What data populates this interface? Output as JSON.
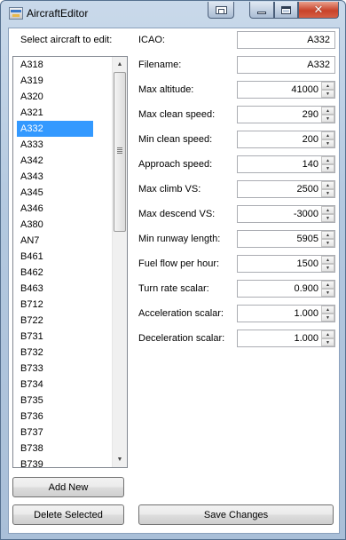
{
  "window": {
    "title": "AircraftEditor"
  },
  "list": {
    "label": "Select aircraft to edit:",
    "selected": "A332",
    "items": [
      "A318",
      "A319",
      "A320",
      "A321",
      "A332",
      "A333",
      "A342",
      "A343",
      "A345",
      "A346",
      "A380",
      "AN7",
      "B461",
      "B462",
      "B463",
      "B712",
      "B722",
      "B731",
      "B732",
      "B733",
      "B734",
      "B735",
      "B736",
      "B737",
      "B738",
      "B739"
    ]
  },
  "fields": {
    "icao": {
      "label": "ICAO:",
      "value": "A332"
    },
    "filename": {
      "label": "Filename:",
      "value": "A332"
    },
    "max_altitude": {
      "label": "Max altitude:",
      "value": "41000"
    },
    "max_clean_speed": {
      "label": "Max clean speed:",
      "value": "290"
    },
    "min_clean_speed": {
      "label": "Min clean speed:",
      "value": "200"
    },
    "approach_speed": {
      "label": "Approach speed:",
      "value": "140"
    },
    "max_climb_vs": {
      "label": "Max climb VS:",
      "value": "2500"
    },
    "max_descend_vs": {
      "label": "Max descend VS:",
      "value": "-3000"
    },
    "min_runway_length": {
      "label": "Min runway length:",
      "value": "5905"
    },
    "fuel_flow": {
      "label": "Fuel flow per hour:",
      "value": "1500"
    },
    "turn_rate_scalar": {
      "label": "Turn rate scalar:",
      "value": "0.900"
    },
    "acceleration_scalar": {
      "label": "Acceleration scalar:",
      "value": "1.000"
    },
    "deceleration_scalar": {
      "label": "Deceleration scalar:",
      "value": "1.000"
    }
  },
  "buttons": {
    "add_new": "Add New",
    "delete_selected": "Delete Selected",
    "save_changes": "Save Changes"
  },
  "icons": {
    "app": "app-window-icon",
    "minimize": "minimize-icon",
    "maximize": "maximize-icon",
    "close": "close-icon",
    "extra": "window-switch-icon"
  },
  "colors": {
    "selection": "#3399ff",
    "close_button": "#c8432a"
  }
}
